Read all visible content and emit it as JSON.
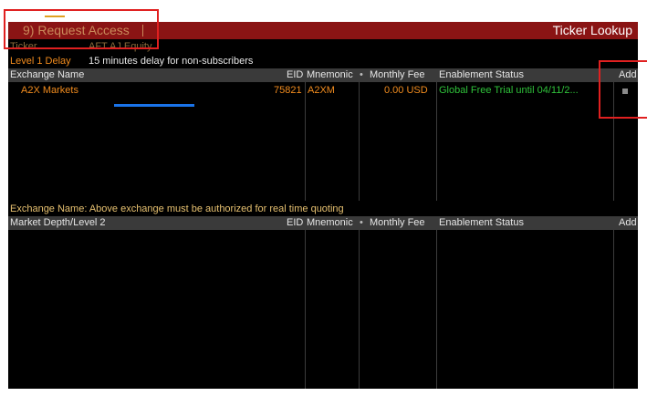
{
  "window": {
    "menu_label": "9) Request Access",
    "title": "Ticker Lookup"
  },
  "info": {
    "ticker_label": "Ticker",
    "ticker_value": "AFT AJ Equity",
    "level_label": "Level 1 Delay",
    "level_value": "15 minutes delay for non-subscribers"
  },
  "table1": {
    "columns": [
      "Exchange Name",
      "EID",
      "Mnemonic",
      "Monthly Fee",
      "Enablement Status",
      "Add"
    ],
    "mnemonic_marker": "•",
    "rows": [
      {
        "exchange_name": "A2X Markets",
        "eid": "75821",
        "mnemonic": "A2XM",
        "monthly_fee": "0.00 USD",
        "status": "Global Free Trial until 04/11/2..."
      }
    ]
  },
  "section2": {
    "note": "Exchange Name: Above exchange must be authorized for real time quoting"
  },
  "table2": {
    "columns": [
      "Market Depth/Level 2",
      "EID",
      "Mnemonic",
      "Monthly Fee",
      "Enablement Status",
      "Add"
    ],
    "mnemonic_marker": "•"
  },
  "colors": {
    "titlebar": "#8a1414",
    "accent_orange": "#f28c1e",
    "status_green": "#2fc23a",
    "annotation_red": "#e02020",
    "annotation_blue": "#1a73e8"
  }
}
